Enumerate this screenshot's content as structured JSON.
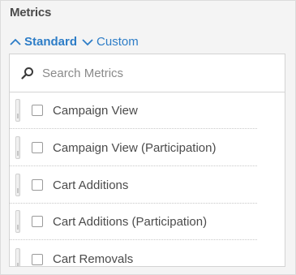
{
  "panel": {
    "title": "Metrics"
  },
  "toggles": {
    "standard_label": "Standard",
    "custom_label": "Custom"
  },
  "search": {
    "placeholder": "Search Metrics",
    "value": ""
  },
  "metrics": {
    "items": [
      {
        "label": "Campaign View"
      },
      {
        "label": "Campaign View (Participation)"
      },
      {
        "label": "Cart Additions"
      },
      {
        "label": "Cart Additions (Participation)"
      },
      {
        "label": "Cart Removals"
      }
    ]
  },
  "colors": {
    "accent": "#2d7dc7",
    "text": "#4b4b4b",
    "background": "#f4f4f4"
  },
  "icons": {
    "standard_toggle": "chevron-up-icon",
    "custom_toggle": "chevron-down-icon",
    "search": "search-icon",
    "drag": "drag-handle-icon"
  }
}
